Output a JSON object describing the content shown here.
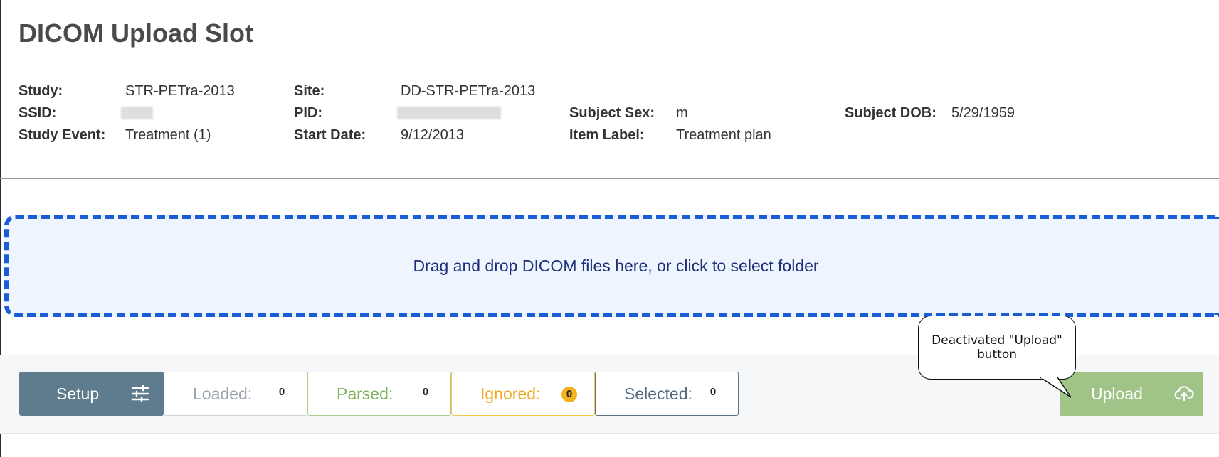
{
  "page": {
    "title": "DICOM Upload Slot"
  },
  "metadata": {
    "study_label": "Study:",
    "study_value": "STR-PETra-2013",
    "ssid_label": "SSID:",
    "ssid_value": "",
    "study_event_label": "Study Event:",
    "study_event_value": "Treatment (1)",
    "site_label": "Site:",
    "site_value": "DD-STR-PETra-2013",
    "pid_label": "PID:",
    "pid_value": "",
    "start_date_label": "Start Date:",
    "start_date_value": "9/12/2013",
    "subject_sex_label": "Subject Sex:",
    "subject_sex_value": "m",
    "item_label_label": "Item Label:",
    "item_label_value": "Treatment plan",
    "subject_dob_label": "Subject DOB:",
    "subject_dob_value": "5/29/1959"
  },
  "dropzone": {
    "text": "Drag and drop DICOM files here, or click to select folder"
  },
  "toolbar": {
    "setup_label": "Setup",
    "setup_icon": "sliders-icon",
    "loaded_label": "Loaded:",
    "loaded_count": "0",
    "parsed_label": "Parsed:",
    "parsed_count": "0",
    "ignored_label": "Ignored:",
    "ignored_count": "0",
    "selected_label": "Selected:",
    "selected_count": "0",
    "upload_label": "Upload",
    "upload_icon": "cloud-upload-icon",
    "upload_disabled": true
  },
  "annotation": {
    "callout_text": "Deactivated \"Upload\" button"
  },
  "colors": {
    "dropzone_border": "#1a5dd6",
    "setup_bg": "#5e7c8d",
    "upload_bg": "#9cc281",
    "parsed": "#7fb35b",
    "ignored": "#f0a820"
  }
}
